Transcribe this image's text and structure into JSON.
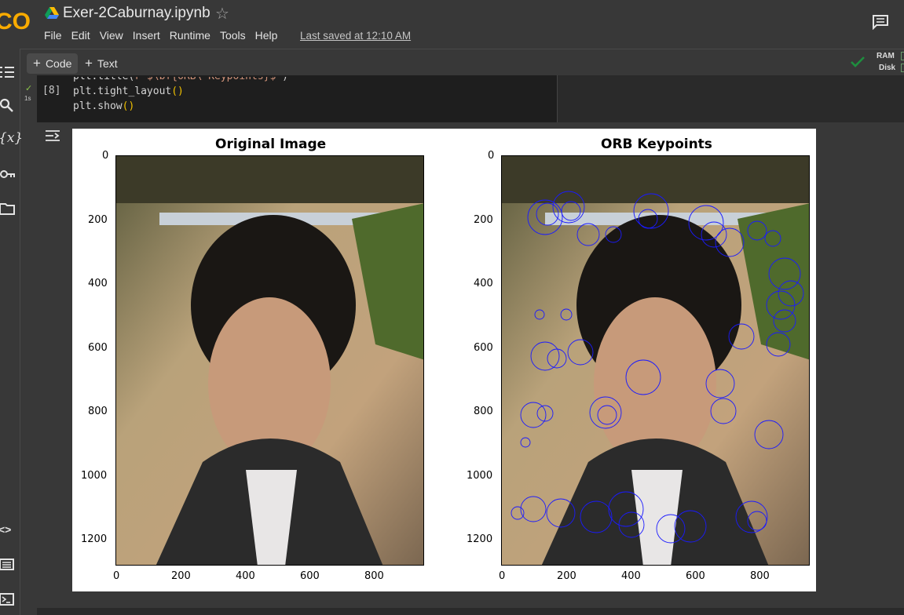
{
  "header": {
    "logo_text": "CO",
    "notebook_title": "Exer-2Caburnay.ipynb",
    "menu": [
      "File",
      "Edit",
      "View",
      "Insert",
      "Runtime",
      "Tools",
      "Help"
    ],
    "last_saved": "Last saved at 12:10 AM"
  },
  "toolbar": {
    "code_label": "Code",
    "text_label": "Text",
    "ram_label": "RAM",
    "disk_label": "Disk"
  },
  "cell": {
    "exec_count": "[8]",
    "run_time": "1s",
    "lines": [
      "plt.title(r'$\\bf{ORB\\ Keypoints}$')",
      "plt.tight_layout()",
      "plt.show()"
    ]
  },
  "figure": {
    "left_title": "Original Image",
    "right_title": "ORB Keypoints",
    "y_ticks": [
      "0",
      "200",
      "400",
      "600",
      "800",
      "1000",
      "1200"
    ],
    "x_ticks": [
      "0",
      "200",
      "400",
      "600",
      "800"
    ]
  },
  "colors": {
    "background": "#383838",
    "code_bg": "#1e1e1e",
    "accent_green": "#1e8e3e",
    "keypoint_blue": "#1a1aff",
    "logo_orange": "#f9ab00"
  }
}
